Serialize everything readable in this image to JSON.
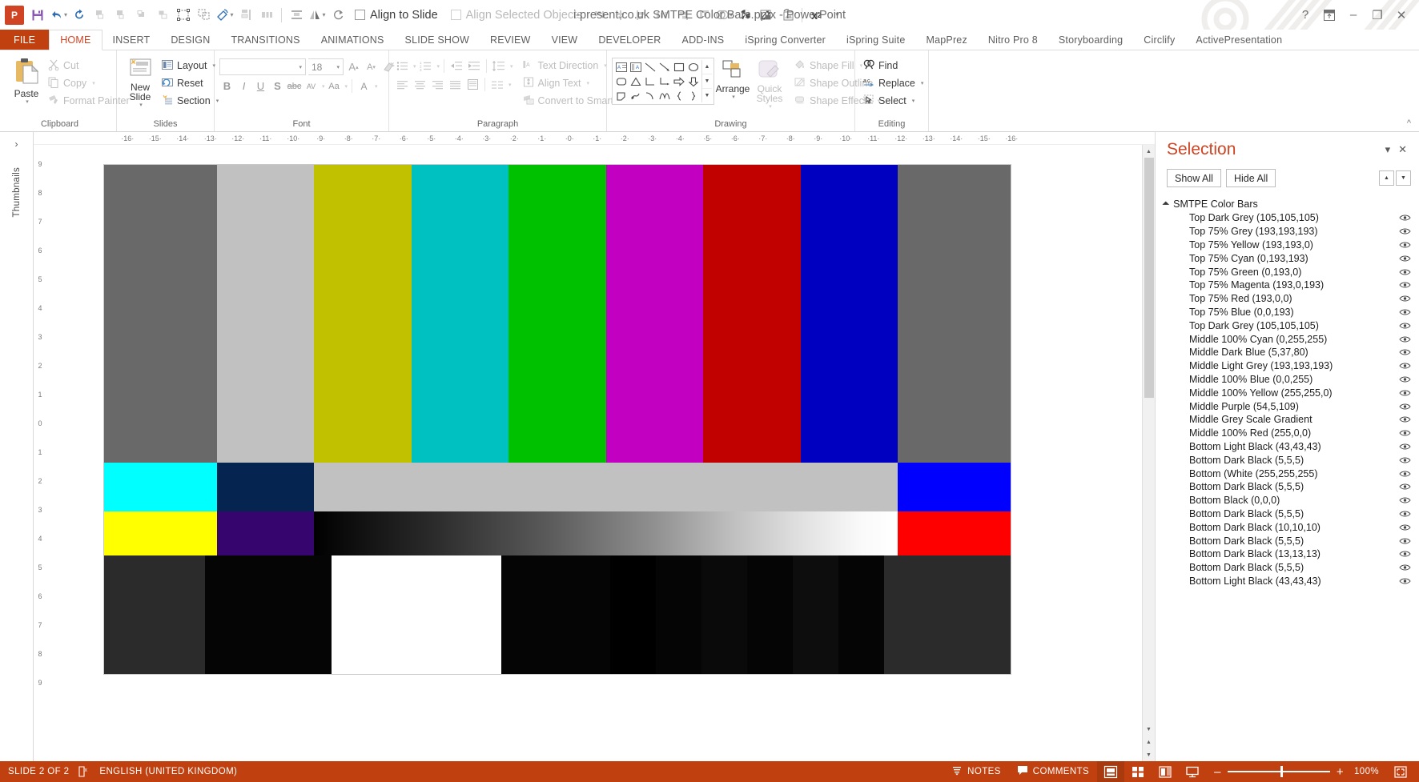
{
  "window": {
    "title": "i-present.co.uk SMTPE Color Bars.pptx - PowerPoint",
    "help_label": "?",
    "ribbon_display_label": "ribbon-display",
    "minimize_label": "–",
    "restore_label": "❐",
    "close_label": "✕",
    "accent_color": "#d04423",
    "file_tab_color": "#c0400f"
  },
  "qat": {
    "logo": "P",
    "items": [
      {
        "name": "save-icon",
        "label": "Save"
      },
      {
        "name": "undo-icon",
        "label": "Undo"
      },
      {
        "name": "redo-icon",
        "label": "Redo"
      },
      {
        "name": "align-left-icon",
        "label": "Align Left"
      },
      {
        "name": "align-center-icon",
        "label": "Align Center"
      },
      {
        "name": "align-right-icon",
        "label": "Align Right"
      },
      {
        "name": "align-bottom-icon",
        "label": "Align Bottom"
      },
      {
        "name": "group-icon",
        "label": "Group"
      },
      {
        "name": "ungroup-icon",
        "label": "Ungroup"
      },
      {
        "name": "rotate-objects-icon",
        "label": "Rotate Objects"
      },
      {
        "name": "distribute-vertical-icon",
        "label": "Distribute Vertically"
      },
      {
        "name": "distribute-horizontal-icon",
        "label": "Distribute Horizontally"
      },
      {
        "name": "align-middle-icon",
        "label": "Align Middle"
      },
      {
        "name": "flip-icon",
        "label": "Flip"
      },
      {
        "name": "rotate-icon",
        "label": "Rotate"
      }
    ],
    "align_to_slide": "Align to Slide",
    "align_selected_objects": "Align Selected Objects",
    "items_right": [
      {
        "name": "distribute-down-icon",
        "label": "Distribute Down"
      },
      {
        "name": "align-center-2-icon",
        "label": "Align Center"
      },
      {
        "name": "align-left-2-icon",
        "label": "Align Left"
      },
      {
        "name": "distribute-mid-icon",
        "label": "Distribute"
      },
      {
        "name": "align-right-2-icon",
        "label": "Align Right"
      },
      {
        "name": "align-top-icon",
        "label": "Align Top"
      },
      {
        "name": "merge-shapes-icon",
        "label": "Merge Shapes"
      },
      {
        "name": "color-wheel-icon",
        "label": "Colors"
      },
      {
        "name": "edit-shape-icon",
        "label": "Edit Shape"
      },
      {
        "name": "change-picture-icon",
        "label": "Change Picture"
      }
    ],
    "superscript": "x",
    "superscript_sup": "2",
    "customize_label": "Customize Quick Access Toolbar"
  },
  "tabs": [
    {
      "label": "FILE",
      "kind": "file"
    },
    {
      "label": "HOME",
      "kind": "active"
    },
    {
      "label": "INSERT",
      "kind": "normal"
    },
    {
      "label": "DESIGN",
      "kind": "normal"
    },
    {
      "label": "TRANSITIONS",
      "kind": "normal"
    },
    {
      "label": "ANIMATIONS",
      "kind": "normal"
    },
    {
      "label": "SLIDE SHOW",
      "kind": "normal"
    },
    {
      "label": "REVIEW",
      "kind": "normal"
    },
    {
      "label": "VIEW",
      "kind": "normal"
    },
    {
      "label": "DEVELOPER",
      "kind": "normal"
    },
    {
      "label": "ADD-INS",
      "kind": "normal"
    },
    {
      "label": "iSpring Converter",
      "kind": "normal"
    },
    {
      "label": "iSpring Suite",
      "kind": "normal"
    },
    {
      "label": "MapPrez",
      "kind": "normal"
    },
    {
      "label": "Nitro Pro 8",
      "kind": "normal"
    },
    {
      "label": "Storyboarding",
      "kind": "normal"
    },
    {
      "label": "Circlify",
      "kind": "normal"
    },
    {
      "label": "ActivePresentation",
      "kind": "normal"
    }
  ],
  "ribbon": {
    "collapse_label": "^",
    "groups": {
      "clipboard": {
        "label": "Clipboard",
        "paste": "Paste",
        "cut": "Cut",
        "copy": "Copy",
        "format_painter": "Format Painter"
      },
      "slides": {
        "label": "Slides",
        "new_slide": "New Slide",
        "layout": "Layout",
        "reset": "Reset",
        "section": "Section"
      },
      "font": {
        "label": "Font",
        "font_name": "",
        "font_name_placeholder": "",
        "font_size": "18",
        "grow": "A",
        "shrink": "A",
        "clear_formatting": "Clear All Formatting",
        "bold": "B",
        "italic": "I",
        "underline": "U",
        "shadow": "S",
        "strikethrough": "abc",
        "character_spacing": "AV",
        "change_case": "Aa",
        "font_color": "A"
      },
      "paragraph": {
        "label": "Paragraph",
        "text_direction": "Text Direction",
        "align_text": "Align Text",
        "convert_to_smartart": "Convert to SmartArt"
      },
      "drawing": {
        "label": "Drawing",
        "arrange": "Arrange",
        "quick_styles": "Quick Styles",
        "shape_fill": "Shape Fill",
        "shape_outline": "Shape Outline",
        "shape_effects": "Shape Effects"
      },
      "editing": {
        "label": "Editing",
        "find": "Find",
        "replace": "Replace",
        "select": "Select"
      }
    }
  },
  "left_panel": {
    "thumbnails_label": "Thumbnails",
    "expand_icon": "chevron-right-icon"
  },
  "rulers": {
    "horizontal": [
      "16",
      "15",
      "14",
      "13",
      "12",
      "11",
      "10",
      "9",
      "8",
      "7",
      "6",
      "5",
      "4",
      "3",
      "2",
      "1",
      "0",
      "1",
      "2",
      "3",
      "4",
      "5",
      "6",
      "7",
      "8",
      "9",
      "10",
      "11",
      "12",
      "13",
      "14",
      "15",
      "16"
    ],
    "vertical": [
      "9",
      "8",
      "7",
      "6",
      "5",
      "4",
      "3",
      "2",
      "1",
      "0",
      "1",
      "2",
      "3",
      "4",
      "5",
      "6",
      "7",
      "8",
      "9"
    ]
  },
  "selection_pane": {
    "title": "Selection",
    "show_all": "Show All",
    "hide_all": "Hide All",
    "move_up_label": "Bring Forward",
    "move_down_label": "Send Backward",
    "collapse_icon": "chevron-down-icon",
    "close_icon": "close-icon",
    "group_name": "SMTPE Color Bars",
    "eye_icon": "eye-icon",
    "items": [
      "Top Dark Grey (105,105,105)",
      "Top 75% Grey (193,193,193)",
      "Top 75% Yellow (193,193,0)",
      "Top 75% Cyan (0,193,193)",
      "Top 75% Green (0,193,0)",
      "Top 75% Magenta (193,0,193)",
      "Top 75% Red (193,0,0)",
      "Top 75% Blue (0,0,193)",
      "Top Dark Grey (105,105,105)",
      "Middle 100% Cyan (0,255,255)",
      "Middle Dark Blue (5,37,80)",
      "Middle Light Grey (193,193,193)",
      "Middle 100% Blue (0,0,255)",
      "Middle 100% Yellow (255,255,0)",
      "Middle Purple (54,5,109)",
      "Middle Grey Scale Gradient",
      "Middle 100% Red (255,0,0)",
      "Bottom Light Black (43,43,43)",
      "Bottom Dark Black (5,5,5)",
      "Bottom (White (255,255,255)",
      "Bottom Dark Black (5,5,5)",
      "Bottom Black (0,0,0)",
      "Bottom Dark Black (5,5,5)",
      "Bottom Dark Black (10,10,10)",
      "Bottom Dark Black (5,5,5)",
      "Bottom Dark Black (13,13,13)",
      "Bottom Dark Black (5,5,5)",
      "Bottom Light Black (43,43,43)"
    ]
  },
  "slide": {
    "name": "SMTPE Color Bars",
    "top_bars": [
      {
        "name": "Top Dark Grey",
        "color": "#696969",
        "flex": 1.24
      },
      {
        "name": "Top 75% Grey",
        "color": "#c1c1c1",
        "flex": 1.07
      },
      {
        "name": "Top 75% Yellow",
        "color": "#c1c100",
        "flex": 1.07
      },
      {
        "name": "Top 75% Cyan",
        "color": "#00c1c1",
        "flex": 1.07
      },
      {
        "name": "Top 75% Green",
        "color": "#00c100",
        "flex": 1.07
      },
      {
        "name": "Top 75% Magenta",
        "color": "#c100c1",
        "flex": 1.07
      },
      {
        "name": "Top 75% Red",
        "color": "#c10000",
        "flex": 1.07
      },
      {
        "name": "Top 75% Blue",
        "color": "#0000c1",
        "flex": 1.07
      },
      {
        "name": "Top Dark Grey",
        "color": "#696969",
        "flex": 1.24
      }
    ],
    "middle_bars": [
      {
        "name": "Middle 100% Cyan",
        "color": "#00ffff",
        "flex": 1.24
      },
      {
        "name": "Middle Dark Blue",
        "color": "#052550",
        "flex": 1.07
      },
      {
        "name": "Middle Light Grey",
        "color": "#c1c1c1",
        "flex": 6.42
      },
      {
        "name": "Middle 100% Blue",
        "color": "#0000ff",
        "flex": 1.24
      }
    ],
    "gradient_bars": [
      {
        "name": "Middle 100% Yellow",
        "color": "#ffff00",
        "flex": 1.24
      },
      {
        "name": "Middle Purple",
        "color": "#36056d",
        "flex": 1.07
      },
      {
        "name": "Middle Grey Scale Gradient",
        "color": "gradient",
        "flex": 6.42
      },
      {
        "name": "Middle 100% Red",
        "color": "#ff0000",
        "flex": 1.24
      }
    ],
    "bottom_bars": [
      {
        "name": "Bottom Light Black",
        "color": "#2b2b2b",
        "flex": 1.24
      },
      {
        "name": "Bottom Dark Black",
        "color": "#050505",
        "flex": 1.55
      },
      {
        "name": "Bottom White",
        "color": "#ffffff",
        "flex": 2.08
      },
      {
        "name": "Bottom Dark Black",
        "color": "#050505",
        "flex": 1.33
      },
      {
        "name": "Bottom Black",
        "color": "#000000",
        "flex": 0.56
      },
      {
        "name": "Bottom Dark Black",
        "color": "#050505",
        "flex": 0.56
      },
      {
        "name": "Bottom Dark Black",
        "color": "#0a0a0a",
        "flex": 0.56
      },
      {
        "name": "Bottom Dark Black",
        "color": "#050505",
        "flex": 0.56
      },
      {
        "name": "Bottom Dark Black",
        "color": "#0d0d0d",
        "flex": 0.56
      },
      {
        "name": "Bottom Dark Black",
        "color": "#050505",
        "flex": 0.56
      },
      {
        "name": "Bottom Light Black",
        "color": "#2b2b2b",
        "flex": 1.55
      }
    ]
  },
  "statusbar": {
    "slide_counter": "SLIDE 2 OF 2",
    "spellcheck_icon": "spellcheck-icon",
    "language": "ENGLISH (UNITED KINGDOM)",
    "notes": "NOTES",
    "comments": "COMMENTS",
    "views": [
      {
        "name": "normal-view-icon",
        "label": "Normal",
        "active": true
      },
      {
        "name": "slide-sorter-icon",
        "label": "Slide Sorter",
        "active": false
      },
      {
        "name": "reading-view-icon",
        "label": "Reading View",
        "active": false
      },
      {
        "name": "slideshow-icon",
        "label": "Slide Show",
        "active": false
      }
    ],
    "zoom_out": "–",
    "zoom_in": "+",
    "zoom_level": "100%",
    "fit_icon": "fit-slide-icon"
  }
}
